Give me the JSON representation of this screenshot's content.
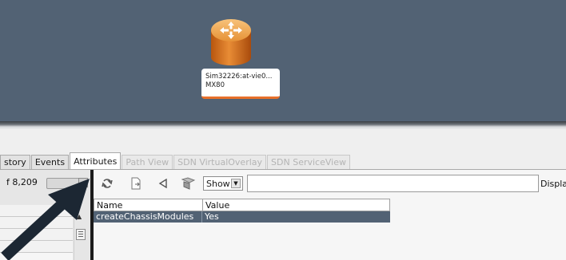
{
  "node": {
    "label_line1": "Sim32226:at-vie0...",
    "label_line2": "MX80",
    "icon": "router-icon",
    "accent": "#e8702a"
  },
  "tabs": [
    {
      "label": "story",
      "state": "normal"
    },
    {
      "label": "Events",
      "state": "normal"
    },
    {
      "label": "Attributes",
      "state": "active"
    },
    {
      "label": "Path View",
      "state": "disabled"
    },
    {
      "label": "SDN VirtualOverlay",
      "state": "disabled"
    },
    {
      "label": "SDN ServiceView",
      "state": "disabled"
    }
  ],
  "left_panel": {
    "count_text": "f 8,209"
  },
  "toolbar": {
    "show_label": "Show",
    "search_value": "",
    "display_label": "Displa"
  },
  "table": {
    "headers": [
      "Name",
      "Value"
    ],
    "rows": [
      {
        "name": "createChassisModules",
        "value": "Yes"
      }
    ]
  },
  "colors": {
    "canvas_bg": "#526274",
    "selected_row_bg": "#526274"
  }
}
